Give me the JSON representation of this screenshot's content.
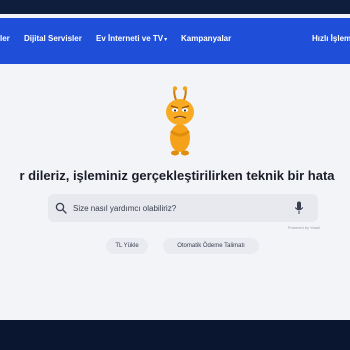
{
  "nav": {
    "items": [
      {
        "label": "ler"
      },
      {
        "label": "Dijital Servisler"
      },
      {
        "label": "Ev İnterneti ve TV",
        "has_dropdown": true
      },
      {
        "label": "Kampanyalar"
      },
      {
        "label": "Hızlı İşleml"
      }
    ]
  },
  "error": {
    "title": "r dileriz, işleminiz gerçekleştirilirken teknik bir hata"
  },
  "search": {
    "placeholder": "Size nasıl yardımcı olabiliriz?",
    "powered_by": "Powered by Yaani"
  },
  "chips": [
    {
      "label": "TL Yükle"
    },
    {
      "label": "Otomatik Ödeme Talimatı"
    }
  ],
  "colors": {
    "nav_bg": "#1f4ed8",
    "page_bg": "#f3f4f7",
    "mascot": "#f5a11a"
  }
}
